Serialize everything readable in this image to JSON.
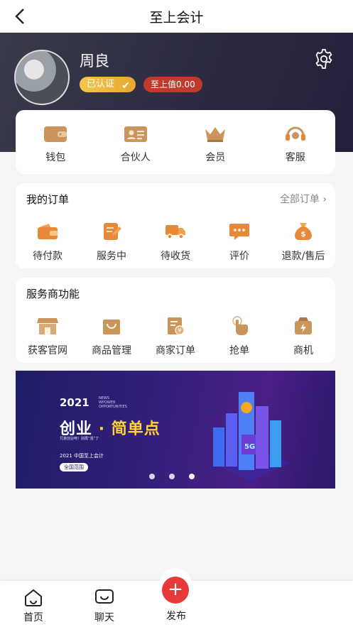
{
  "header": {
    "title": "至上会计"
  },
  "profile": {
    "name": "周良",
    "verified_badge": "已认证",
    "value_badge": "至上值0.00"
  },
  "quick_actions": [
    {
      "label": "钱包",
      "icon": "wallet-icon"
    },
    {
      "label": "合伙人",
      "icon": "id-card-icon"
    },
    {
      "label": "会员",
      "icon": "crown-icon"
    },
    {
      "label": "客服",
      "icon": "headset-icon"
    }
  ],
  "orders": {
    "title": "我的订单",
    "all_link": "全部订单",
    "items": [
      {
        "label": "待付款",
        "icon": "wallet-pay-icon"
      },
      {
        "label": "服务中",
        "icon": "document-edit-icon"
      },
      {
        "label": "待收货",
        "icon": "truck-icon"
      },
      {
        "label": "评价",
        "icon": "chat-bubble-icon"
      },
      {
        "label": "退款/售后",
        "icon": "money-bag-icon"
      }
    ]
  },
  "services": {
    "title": "服务商功能",
    "items": [
      {
        "label": "获客官网",
        "icon": "storefront-icon"
      },
      {
        "label": "商品管理",
        "icon": "shopping-bag-icon"
      },
      {
        "label": "商家订单",
        "icon": "invoice-icon"
      },
      {
        "label": "抢单",
        "icon": "hand-tap-icon"
      },
      {
        "label": "商机",
        "icon": "lightning-bag-icon"
      }
    ]
  },
  "banner": {
    "year": "2021",
    "sub_lines": [
      "NEWS",
      "WPOWER",
      "OPPORTUNITIES"
    ],
    "headline_left": "创业",
    "headline_dot": "·",
    "headline_right": "简单点",
    "tagline": "兄弟创业吧！别再“混”了",
    "line": "2021 中国至上会计",
    "pill": "全国范围",
    "city_badge": "5G",
    "slides": 3,
    "active_slide": 3
  },
  "tabbar": {
    "home": "首页",
    "chat": "聊天",
    "publish": "发布",
    "publish_symbol": "+"
  },
  "colors": {
    "accent": "#e8393a",
    "icon_orange": "#e8893a",
    "icon_tan": "#c9955a",
    "gold": "#f0b93c"
  }
}
